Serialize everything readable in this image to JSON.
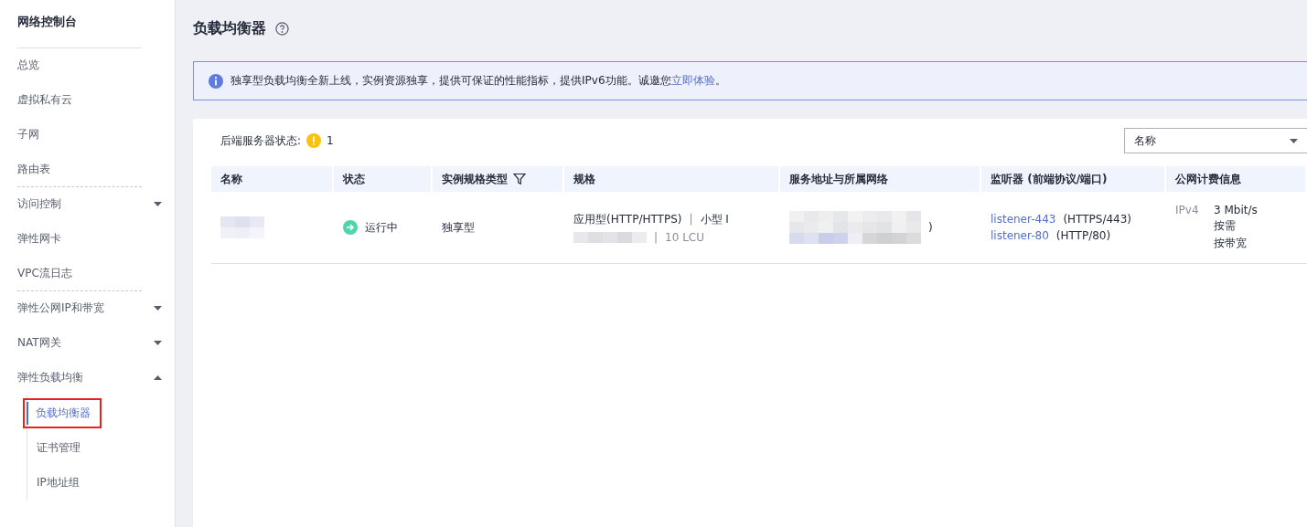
{
  "sidebar": {
    "title": "网络控制台",
    "items": [
      {
        "label": "总览",
        "divider_after": false
      },
      {
        "label": "虚拟私有云",
        "divider_after": false
      },
      {
        "label": "子网",
        "divider_after": false
      },
      {
        "label": "路由表",
        "divider_after": true
      },
      {
        "label": "访问控制",
        "expanded": false,
        "divider_after": false
      },
      {
        "label": "弹性网卡",
        "divider_after": false
      },
      {
        "label": "VPC流日志",
        "divider_after": true
      },
      {
        "label": "弹性公网IP和带宽",
        "expanded": false,
        "divider_after": false
      },
      {
        "label": "NAT网关",
        "expanded": false,
        "divider_after": false
      },
      {
        "label": "弹性负载均衡",
        "expanded": true,
        "divider_after": false,
        "children": [
          {
            "label": "负载均衡器",
            "selected": true
          },
          {
            "label": "证书管理",
            "selected": false
          },
          {
            "label": "IP地址组",
            "selected": false
          }
        ]
      }
    ]
  },
  "page": {
    "title": "负载均衡器",
    "notice": {
      "text": "独享型负载均衡全新上线，实例资源独享，提供可保证的性能指标，提供IPv6功能。诚邀您",
      "link": "立即体验",
      "end": "。"
    }
  },
  "status_filter": {
    "label": "后端服务器状态:",
    "count": "1"
  },
  "search": {
    "field": "名称"
  },
  "table": {
    "columns": [
      "名称",
      "状态",
      "实例规格类型",
      "规格",
      "服务地址与所属网络",
      "监听器 (前端协议/端口)",
      "公网计费信息"
    ],
    "rows": [
      {
        "status": "运行中",
        "type": "独享型",
        "spec": "应用型(HTTP/HTTPS)",
        "spec_sep": "|",
        "spec_size": "小型 I",
        "spec_sep2": "|",
        "spec_lcu": "10 LCU",
        "address_tail": ")",
        "listeners": [
          {
            "name": "listener-443",
            "proto": "(HTTPS/443)"
          },
          {
            "name": "listener-80",
            "proto": "(HTTP/80)"
          }
        ],
        "billing": {
          "ip": "IPv4",
          "bandwidth": "3 Mbit/s",
          "mode": "按需",
          "charge": "按带宽"
        }
      }
    ]
  }
}
